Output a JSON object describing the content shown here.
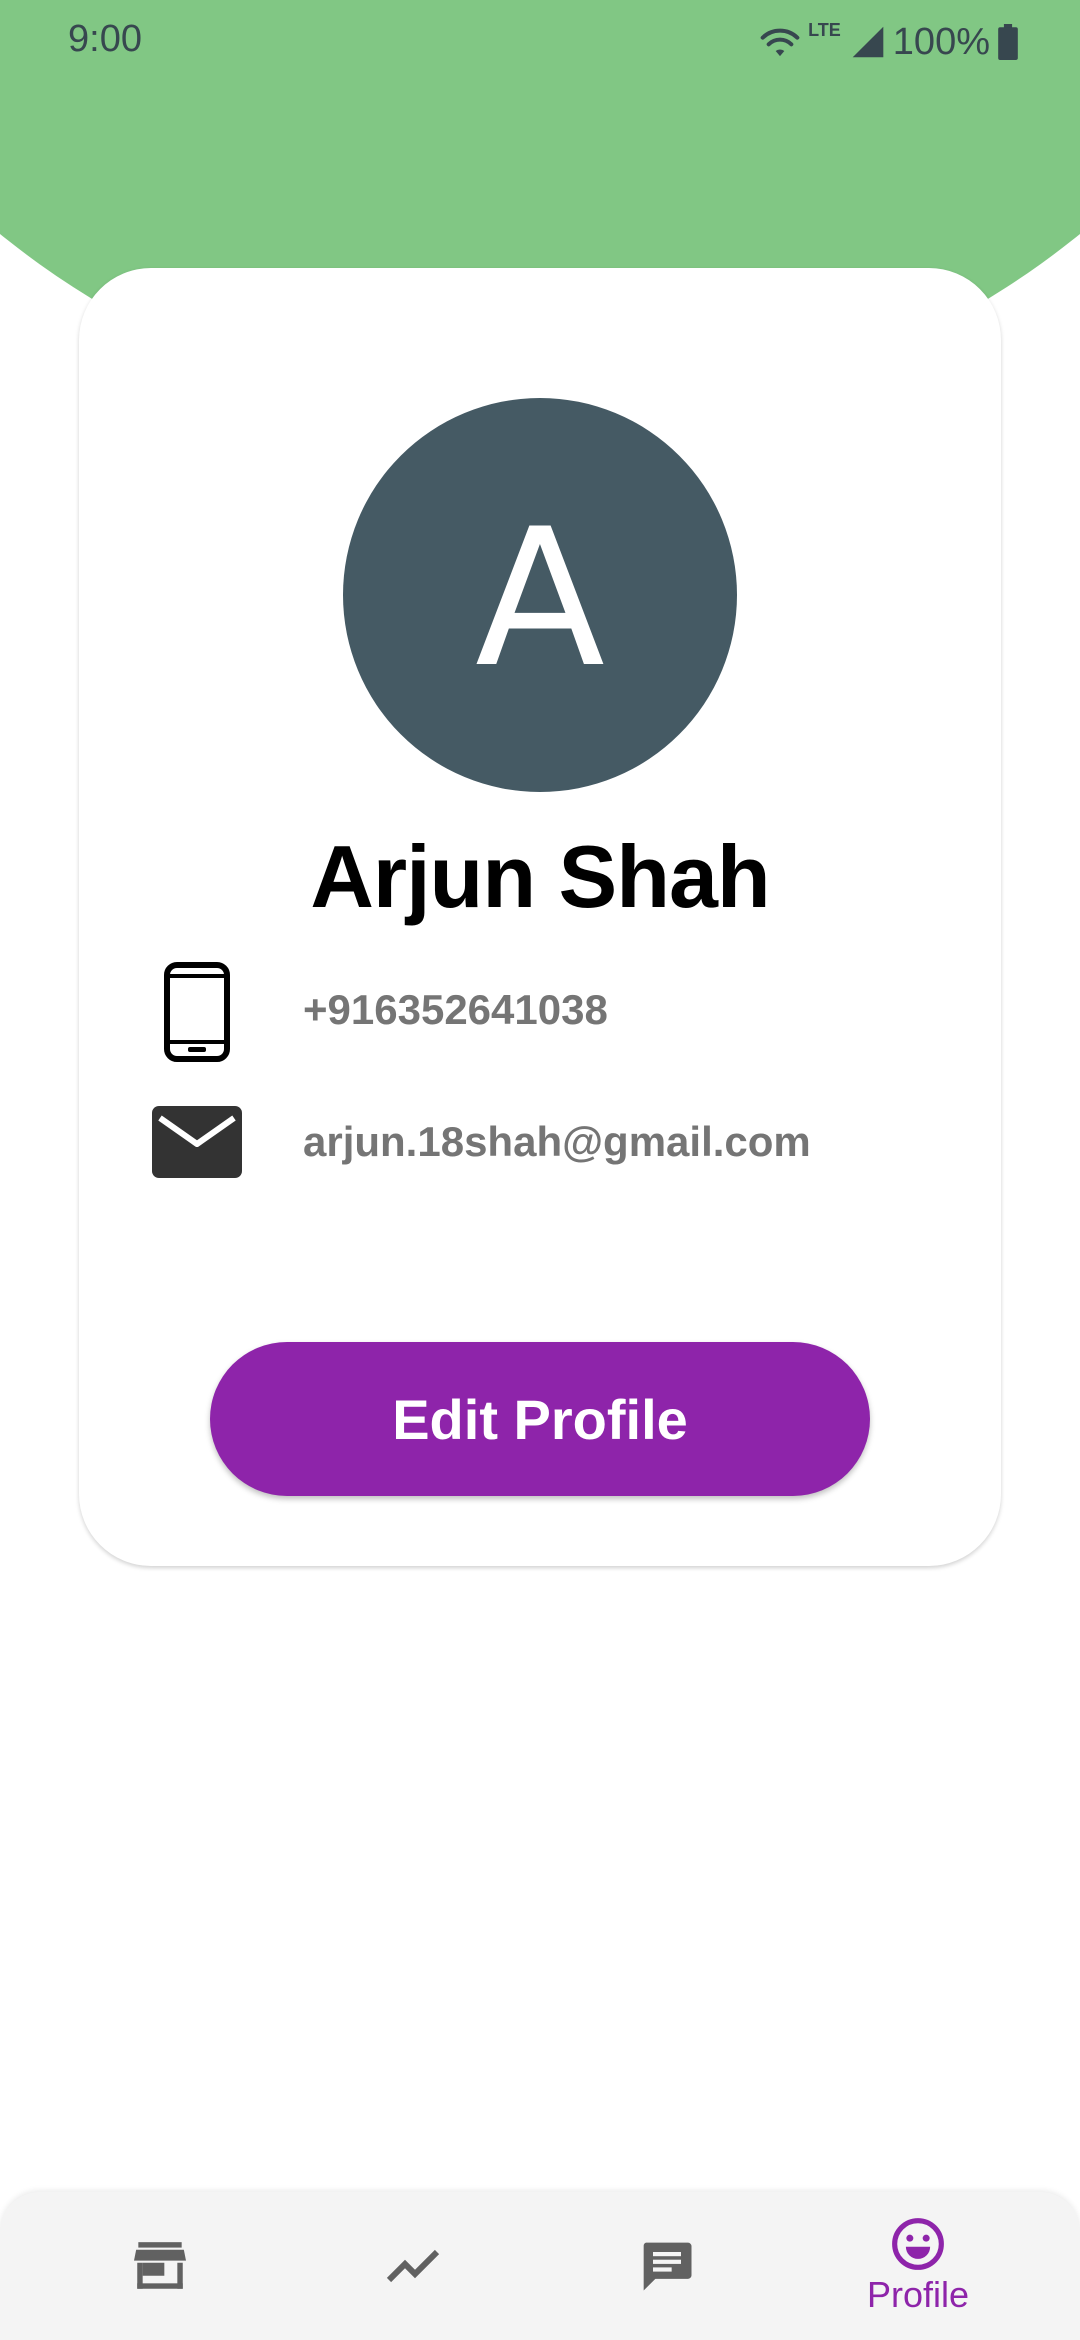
{
  "status_bar": {
    "time": "9:00",
    "network": "LTE",
    "battery": "100%",
    "icons": [
      "wifi-icon",
      "signal-icon",
      "battery-icon"
    ]
  },
  "profile": {
    "avatar_letter": "A",
    "name": "Arjun Shah",
    "phone": "+916352641038",
    "email": "arjun.18shah@gmail.com",
    "edit_label": "Edit Profile"
  },
  "bottom_nav": {
    "items": [
      {
        "icon": "store-icon",
        "label": ""
      },
      {
        "icon": "trending-icon",
        "label": ""
      },
      {
        "icon": "chat-icon",
        "label": ""
      },
      {
        "icon": "smiley-icon",
        "label": "Profile"
      }
    ]
  },
  "colors": {
    "header_green": "#81c784",
    "accent_purple": "#8e24aa",
    "avatar_bg": "#455a64",
    "secondary_text": "#757575"
  }
}
